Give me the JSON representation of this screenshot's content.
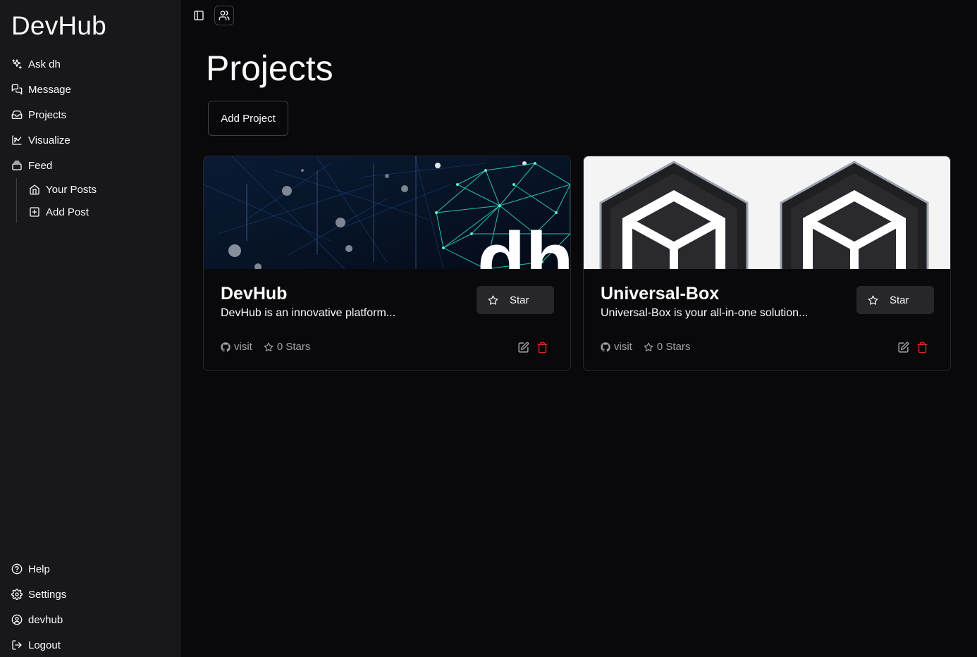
{
  "sidebar": {
    "brand": "DevHub",
    "nav": [
      {
        "label": "Ask dh",
        "icon": "sparkles-icon"
      },
      {
        "label": "Message",
        "icon": "messages-icon"
      },
      {
        "label": "Projects",
        "icon": "inbox-icon"
      },
      {
        "label": "Visualize",
        "icon": "chart-icon"
      },
      {
        "label": "Feed",
        "icon": "stack-icon"
      }
    ],
    "feed_sub": [
      {
        "label": "Your Posts",
        "icon": "home-icon"
      },
      {
        "label": "Add Post",
        "icon": "plus-square-icon"
      }
    ],
    "bottom": [
      {
        "label": "Help",
        "icon": "help-circle-icon"
      },
      {
        "label": "Settings",
        "icon": "gear-icon"
      },
      {
        "label": "devhub",
        "icon": "user-circle-icon"
      },
      {
        "label": "Logout",
        "icon": "logout-icon"
      }
    ]
  },
  "topbar": {
    "toggle_icon": "sidebar-toggle-icon",
    "users_icon": "users-icon"
  },
  "main": {
    "title": "Projects",
    "add_project_label": "Add Project"
  },
  "projects": [
    {
      "name": "DevHub",
      "description": "DevHub is an innovative platform...",
      "star_label": "Star",
      "visit_label": "visit",
      "stars_label": "0 Stars",
      "image_text": "dh"
    },
    {
      "name": "Universal-Box",
      "description": "Universal-Box is your all-in-one solution...",
      "star_label": "Star",
      "visit_label": "visit",
      "stars_label": "0 Stars"
    }
  ],
  "colors": {
    "background": "#09090b",
    "sidebar": "#18181b",
    "border": "#27272a",
    "muted_text": "#a1a1aa",
    "danger": "#dc2626",
    "accent_teal": "#2dd4bf"
  }
}
